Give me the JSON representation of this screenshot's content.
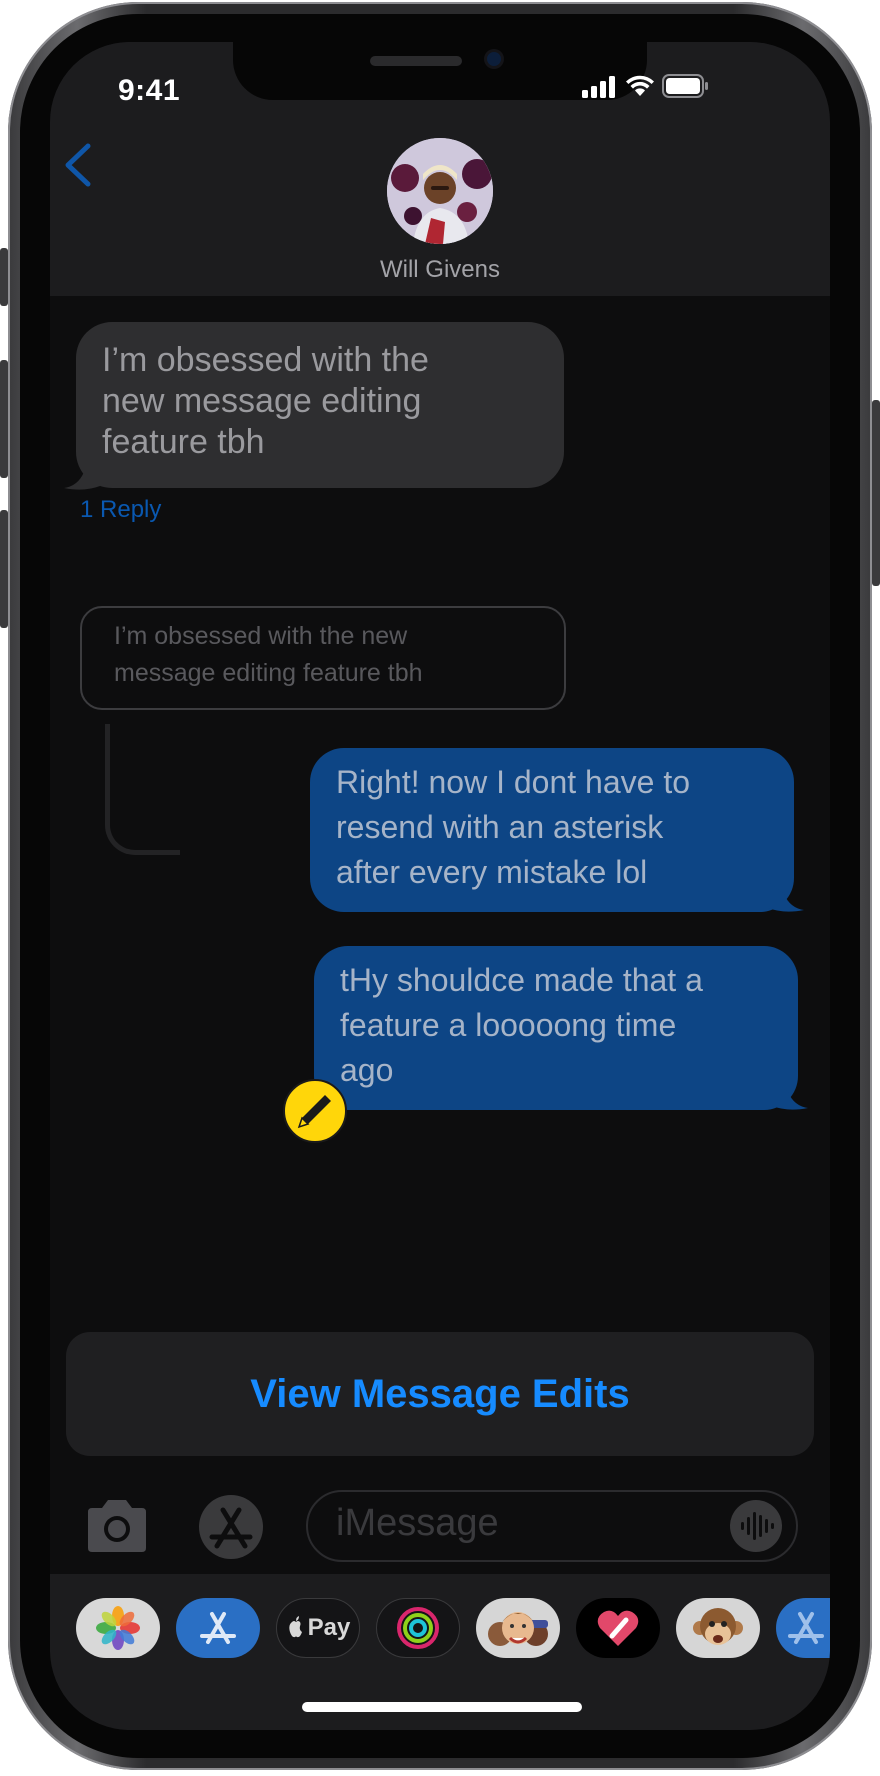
{
  "status_bar": {
    "time": "9:41"
  },
  "header": {
    "contact_name": "Will Givens",
    "back_icon": "chevron-left-icon"
  },
  "messages": {
    "incoming": {
      "lines": [
        "I’m obsessed with the",
        "new message editing",
        "feature tbh"
      ],
      "reply_link": "1 Reply"
    },
    "quoted": {
      "lines": [
        "I’m obsessed with the new",
        "message editing feature tbh"
      ]
    },
    "outgoing": [
      {
        "lines": [
          "Right! now I dont have to",
          "resend with an asterisk",
          "after every mistake lol"
        ]
      },
      {
        "lines": [
          "tHy shouldce made that a",
          "feature a looooong time",
          "ago"
        ]
      }
    ],
    "edit_badge_icon": "pencil-icon"
  },
  "edits_button": {
    "label": "View Message Edits"
  },
  "composer": {
    "placeholder": "iMessage",
    "camera_icon": "camera-icon",
    "apps_icon": "app-store-icon",
    "audio_icon": "waveform-icon"
  },
  "apps": [
    {
      "name": "photos-icon"
    },
    {
      "name": "app-store-icon"
    },
    {
      "name": "apple-pay-icon",
      "label": "Pay"
    },
    {
      "name": "activity-icon"
    },
    {
      "name": "memoji-icon"
    },
    {
      "name": "digital-touch-icon"
    },
    {
      "name": "animoji-icon"
    },
    {
      "name": "app-store-extra-icon"
    }
  ],
  "colors": {
    "accent": "#168bff",
    "outgoing_bubble": "#0d4585",
    "incoming_bubble": "#2e2e30",
    "badge": "#ffd60a"
  }
}
